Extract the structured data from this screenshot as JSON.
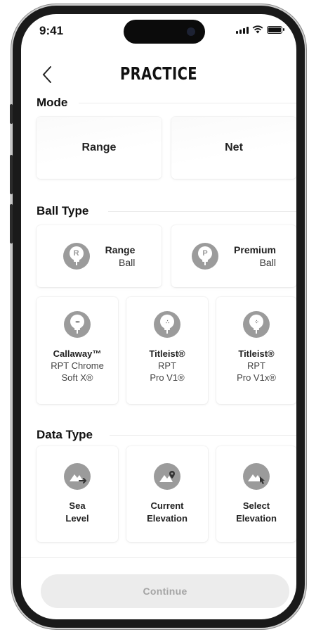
{
  "status_bar": {
    "time": "9:41"
  },
  "header": {
    "title": "PRACTICE"
  },
  "mode": {
    "label": "Mode",
    "options": [
      {
        "label": "Range"
      },
      {
        "label": "Net"
      }
    ]
  },
  "ball_type": {
    "label": "Ball Type",
    "top": [
      {
        "badge": "R",
        "line1": "Range",
        "line2": "Ball"
      },
      {
        "badge": "P",
        "line1": "Premium",
        "line2": "Ball"
      }
    ],
    "bottom": [
      {
        "line1": "Callaway™",
        "line2": "RPT Chrome",
        "line3": "Soft X®"
      },
      {
        "line1": "Titleist®",
        "line2": "RPT",
        "line3": "Pro V1®"
      },
      {
        "line1": "Titleist®",
        "line2": "RPT",
        "line3": "Pro V1x®"
      }
    ]
  },
  "data_type": {
    "label": "Data Type",
    "options": [
      {
        "line1": "Sea",
        "line2": "Level",
        "icon": "mountain-arrow-icon"
      },
      {
        "line1": "Current",
        "line2": "Elevation",
        "icon": "mountain-pin-icon"
      },
      {
        "line1": "Select",
        "line2": "Elevation",
        "icon": "mountain-cursor-icon"
      }
    ]
  },
  "footer": {
    "continue_label": "Continue"
  },
  "colors": {
    "icon_gray": "#9b9b9b",
    "button_bg": "#ececec",
    "button_text": "#a4a4a4"
  }
}
